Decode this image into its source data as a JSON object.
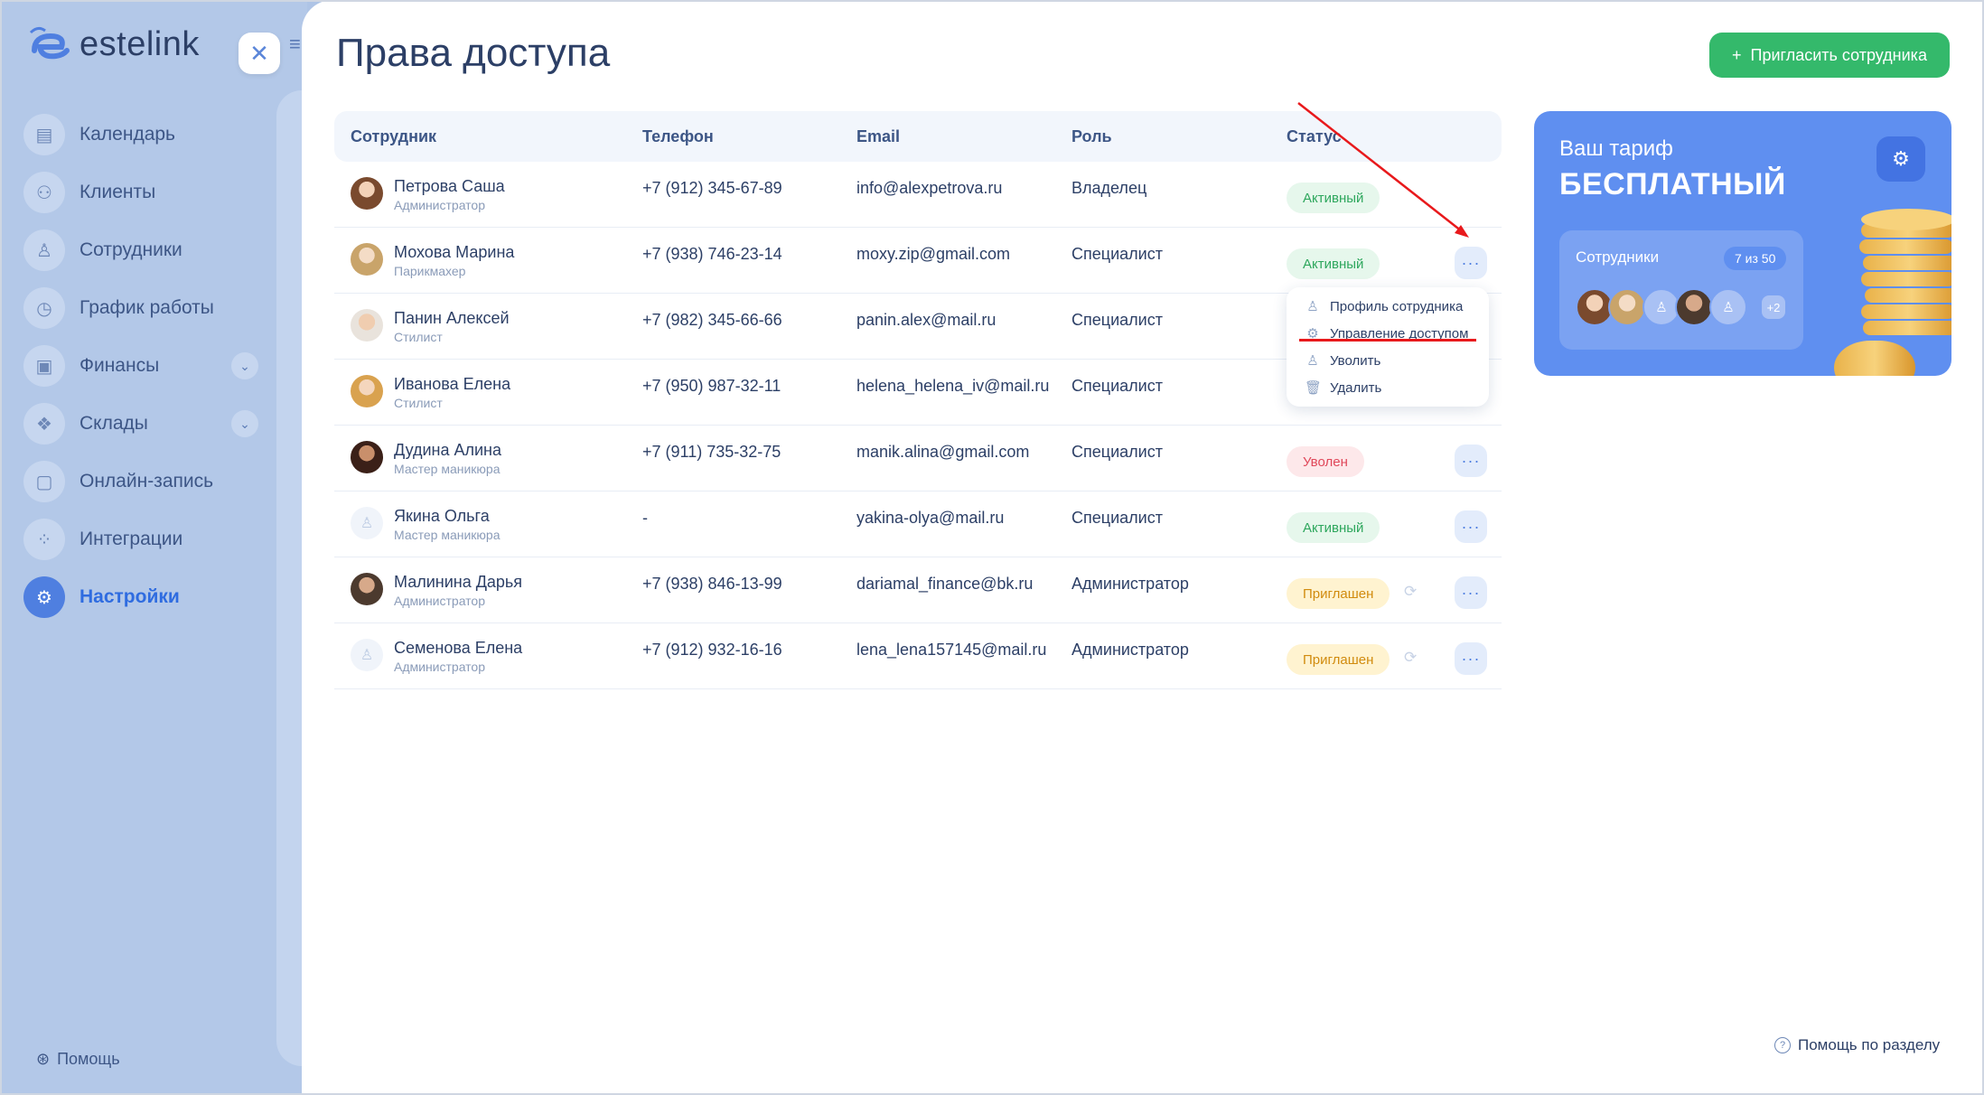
{
  "brand": {
    "name": "estelink"
  },
  "sidebar": {
    "items": [
      {
        "label": "Календарь",
        "icon": "calendar-icon",
        "glyph": "▤"
      },
      {
        "label": "Клиенты",
        "icon": "clients-icon",
        "glyph": "⚇"
      },
      {
        "label": "Сотрудники",
        "icon": "staff-icon",
        "glyph": "♙"
      },
      {
        "label": "График работы",
        "icon": "clock-icon",
        "glyph": "◷"
      },
      {
        "label": "Финансы",
        "icon": "wallet-icon",
        "glyph": "▣",
        "chevron": true
      },
      {
        "label": "Склады",
        "icon": "boxes-icon",
        "glyph": "❖",
        "chevron": true
      },
      {
        "label": "Онлайн-запись",
        "icon": "booking-icon",
        "glyph": "▢"
      },
      {
        "label": "Интеграции",
        "icon": "integrations-icon",
        "glyph": "⁘"
      },
      {
        "label": "Настройки",
        "icon": "settings-icon",
        "glyph": "⚙",
        "active": true
      }
    ],
    "help": "Помощь"
  },
  "page": {
    "title": "Права доступа",
    "invite_button": "Пригласить сотрудника",
    "help_link": "Помощь по разделу"
  },
  "table": {
    "headers": [
      "Сотрудник",
      "Телефон",
      "Email",
      "Роль",
      "Статус"
    ],
    "rows": [
      {
        "name": "Петрова Саша",
        "position": "Администратор",
        "phone": "+7 (912) 345-67-89",
        "email": "info@alexpetrova.ru",
        "role": "Владелец",
        "status": "Активный",
        "status_type": "active",
        "avatar": "photo",
        "menu": false
      },
      {
        "name": "Мохова Марина",
        "position": "Парикмахер",
        "phone": "+7 (938) 746-23-14",
        "email": "moxy.zip@gmail.com",
        "role": "Специалист",
        "status": "Активный",
        "status_type": "active",
        "avatar": "photo2",
        "menu": true
      },
      {
        "name": "Панин Алексей",
        "position": "Стилист",
        "phone": "+7 (982) 345-66-66",
        "email": "panin.alex@mail.ru",
        "role": "Специалист",
        "status": "",
        "status_type": "hidden",
        "avatar": "photo3",
        "menu": false
      },
      {
        "name": "Иванова Елена",
        "position": "Стилист",
        "phone": "+7 (950) 987-32-11",
        "email": "helena_helena_iv@mail.ru",
        "role": "Специалист",
        "status": "",
        "status_type": "hidden",
        "avatar": "photo4",
        "menu": false
      },
      {
        "name": "Дудина Алина",
        "position": "Мастер маникюра",
        "phone": "+7 (911) 735-32-75",
        "email": "manik.alina@gmail.com",
        "role": "Специалист",
        "status": "Уволен",
        "status_type": "fired",
        "avatar": "photo5",
        "menu": true
      },
      {
        "name": "Якина Ольга",
        "position": "Мастер маникюра",
        "phone": "-",
        "email": "yakina-olya@mail.ru",
        "role": "Специалист",
        "status": "Активный",
        "status_type": "active",
        "avatar": "placeholder",
        "menu": true
      },
      {
        "name": "Малинина Дарья",
        "position": "Администратор",
        "phone": "+7 (938) 846-13-99",
        "email": "dariamal_finance@bk.ru",
        "role": "Администратор",
        "status": "Приглашен",
        "status_type": "invited",
        "avatar": "photo6",
        "menu": true,
        "resend": true
      },
      {
        "name": "Семенова Елена",
        "position": "Администратор",
        "phone": "+7 (912) 932-16-16",
        "email": "lena_lena157145@mail.ru",
        "role": "Администратор",
        "status": "Приглашен",
        "status_type": "invited",
        "avatar": "placeholder",
        "menu": true,
        "resend": true
      }
    ]
  },
  "context_menu": {
    "items": [
      {
        "label": "Профиль сотрудника",
        "icon": "user-icon",
        "glyph": "♙"
      },
      {
        "label": "Управление доступом",
        "icon": "gear-icon",
        "glyph": "⚙"
      },
      {
        "label": "Уволить",
        "icon": "user-remove-icon",
        "glyph": "♙"
      },
      {
        "label": "Удалить",
        "icon": "trash-icon",
        "glyph": "🗑"
      }
    ]
  },
  "tariff": {
    "label": "Ваш тариф",
    "plan": "БЕСПЛАТНЫЙ",
    "employees_label": "Сотрудники",
    "employees_count": "7 из 50",
    "more": "+2"
  },
  "colors": {
    "accent": "#4f7fe0",
    "success": "#34b96b",
    "annotation": "#e8191c"
  }
}
